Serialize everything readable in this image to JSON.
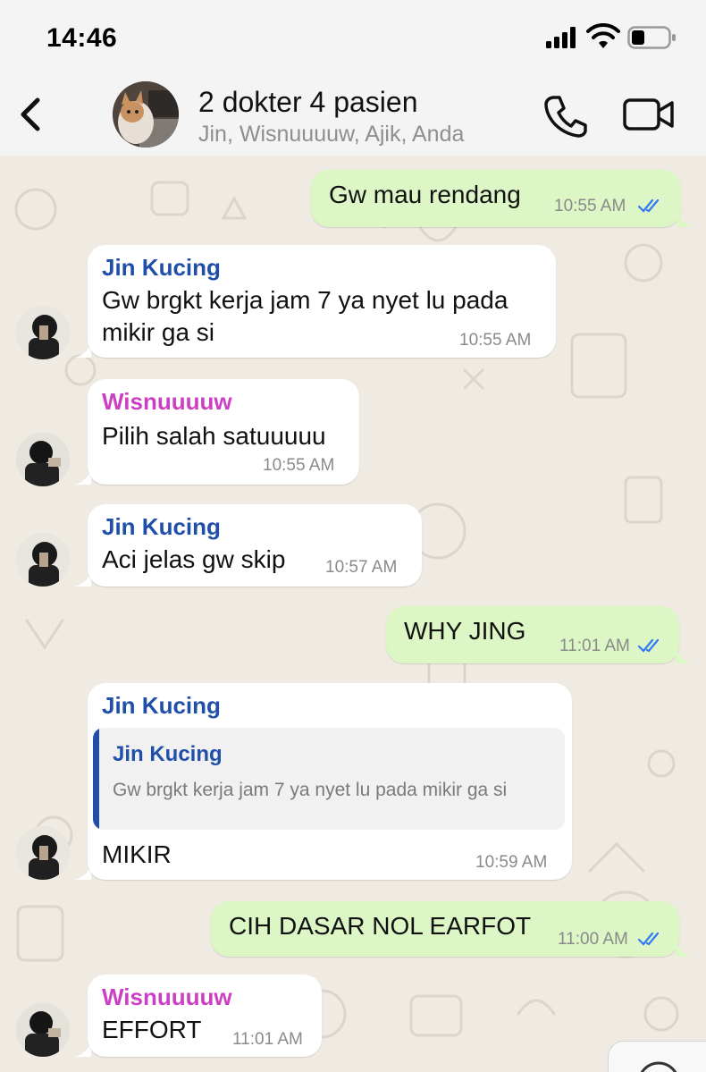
{
  "status_bar": {
    "time": "14:46"
  },
  "header": {
    "title": "2 dokter 4 pasien",
    "subtitle": "Jin, Wisnuuuuw, Ajik, Anda"
  },
  "messages": [
    {
      "text": "Gw mau rendang",
      "time": "10:55 AM"
    },
    {
      "sender": "Jin Kucing",
      "text1": "Gw brgkt kerja jam 7 ya nyet lu pada",
      "text2": "mikir ga si",
      "time": "10:55 AM"
    },
    {
      "sender": "Wisnuuuuw",
      "text": "Pilih salah satuuuuu",
      "time": "10:55 AM"
    },
    {
      "sender": "Jin Kucing",
      "text": "Aci jelas gw skip",
      "time": "10:57 AM"
    },
    {
      "text": "WHY JING",
      "time": "11:01 AM"
    },
    {
      "sender": "Jin Kucing",
      "quote_sender": "Jin Kucing",
      "quote_text": "Gw brgkt kerja jam 7 ya nyet lu pada mikir ga si",
      "text": "MIKIR",
      "time": "10:59 AM"
    },
    {
      "text": "CIH DASAR NOL EARFOT",
      "time": "11:00 AM"
    },
    {
      "sender": "Wisnuuuuw",
      "text": "EFFORT",
      "time": "11:01 AM"
    }
  ],
  "colors": {
    "outgoing_bubble": "#dcf7c5",
    "incoming_bubble": "#ffffff",
    "sender_jin": "#1f4fa8",
    "sender_wisnu": "#cc3fc4",
    "read_ticks": "#3478f6"
  },
  "icons": [
    "back-chevron-icon",
    "phone-icon",
    "video-camera-icon",
    "signal-icon",
    "wifi-icon",
    "battery-icon",
    "double-check-icon",
    "chevron-down-icon"
  ]
}
